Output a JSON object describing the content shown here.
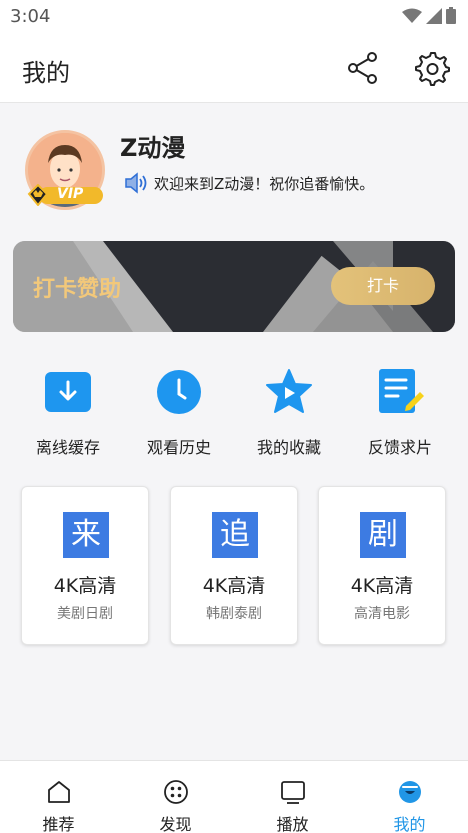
{
  "status_bar": {
    "time": "3:04"
  },
  "header": {
    "title": "我的"
  },
  "profile": {
    "username": "Z动漫",
    "welcome": "欢迎来到Z动漫！祝你追番愉快。",
    "badge": "VIP"
  },
  "checkin": {
    "title": "打卡赞助",
    "button": "打卡"
  },
  "quick_actions": [
    {
      "label": "离线缓存",
      "icon": "download-icon"
    },
    {
      "label": "观看历史",
      "icon": "clock-icon"
    },
    {
      "label": "我的收藏",
      "icon": "star-play-icon"
    },
    {
      "label": "反馈求片",
      "icon": "note-edit-icon"
    }
  ],
  "cards": [
    {
      "char": "来",
      "title": "4K高清",
      "subtitle": "美剧日剧"
    },
    {
      "char": "追",
      "title": "4K高清",
      "subtitle": "韩剧泰剧"
    },
    {
      "char": "剧",
      "title": "4K高清",
      "subtitle": "高清电影"
    }
  ],
  "bottom_nav": [
    {
      "label": "推荐",
      "icon": "home-icon"
    },
    {
      "label": "发现",
      "icon": "discover-icon"
    },
    {
      "label": "播放",
      "icon": "tv-icon"
    },
    {
      "label": "我的",
      "icon": "profile-icon",
      "active": true
    }
  ],
  "colors": {
    "accent": "#2196e6",
    "card_icon": "#3d7be2",
    "gold": "#f2c87a"
  }
}
